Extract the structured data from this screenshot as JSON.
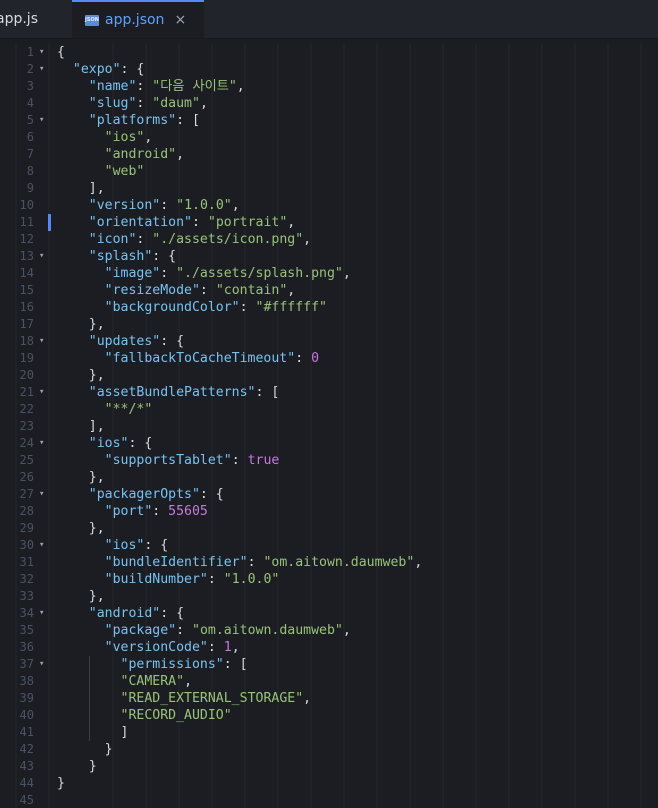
{
  "tabs": [
    {
      "label": "app.js",
      "active": false
    },
    {
      "label": "app.json",
      "active": true,
      "icon": "json-file-icon",
      "close": "×"
    }
  ],
  "icon_text": "JSON",
  "colors": {
    "background": "#1b1d23",
    "key": "#79c2f0",
    "string": "#98c379",
    "number": "#c678dd",
    "accent": "#568af2"
  },
  "lines": [
    {
      "n": "1",
      "fold": "▾",
      "t": [
        {
          "c": "p",
          "v": "{"
        }
      ]
    },
    {
      "n": "2",
      "fold": "▾",
      "t": [
        {
          "c": "p",
          "v": "  "
        },
        {
          "c": "k",
          "v": "\"expo\""
        },
        {
          "c": "p",
          "v": ": {"
        }
      ]
    },
    {
      "n": "3",
      "fold": "",
      "t": [
        {
          "c": "p",
          "v": "    "
        },
        {
          "c": "k",
          "v": "\"name\""
        },
        {
          "c": "p",
          "v": ": "
        },
        {
          "c": "s",
          "v": "\"다음 사이트\""
        },
        {
          "c": "p",
          "v": ","
        }
      ]
    },
    {
      "n": "4",
      "fold": "",
      "t": [
        {
          "c": "p",
          "v": "    "
        },
        {
          "c": "k",
          "v": "\"slug\""
        },
        {
          "c": "p",
          "v": ": "
        },
        {
          "c": "s",
          "v": "\"daum\""
        },
        {
          "c": "p",
          "v": ","
        }
      ]
    },
    {
      "n": "5",
      "fold": "▾",
      "t": [
        {
          "c": "p",
          "v": "    "
        },
        {
          "c": "k",
          "v": "\"platforms\""
        },
        {
          "c": "p",
          "v": ": ["
        }
      ]
    },
    {
      "n": "6",
      "fold": "",
      "t": [
        {
          "c": "p",
          "v": "      "
        },
        {
          "c": "s",
          "v": "\"ios\""
        },
        {
          "c": "p",
          "v": ","
        }
      ]
    },
    {
      "n": "7",
      "fold": "",
      "t": [
        {
          "c": "p",
          "v": "      "
        },
        {
          "c": "s",
          "v": "\"android\""
        },
        {
          "c": "p",
          "v": ","
        }
      ]
    },
    {
      "n": "8",
      "fold": "",
      "t": [
        {
          "c": "p",
          "v": "      "
        },
        {
          "c": "s",
          "v": "\"web\""
        }
      ]
    },
    {
      "n": "9",
      "fold": "",
      "t": [
        {
          "c": "p",
          "v": "    ],"
        }
      ]
    },
    {
      "n": "10",
      "fold": "",
      "t": [
        {
          "c": "p",
          "v": "    "
        },
        {
          "c": "k",
          "v": "\"version\""
        },
        {
          "c": "p",
          "v": ": "
        },
        {
          "c": "s",
          "v": "\"1.0.0\""
        },
        {
          "c": "p",
          "v": ","
        }
      ]
    },
    {
      "n": "11",
      "fold": "",
      "cursor": true,
      "t": [
        {
          "c": "p",
          "v": "    "
        },
        {
          "c": "k",
          "v": "\"orientation\""
        },
        {
          "c": "p",
          "v": ": "
        },
        {
          "c": "s",
          "v": "\"portrait\""
        },
        {
          "c": "p",
          "v": ","
        }
      ]
    },
    {
      "n": "12",
      "fold": "",
      "t": [
        {
          "c": "p",
          "v": "    "
        },
        {
          "c": "k",
          "v": "\"icon\""
        },
        {
          "c": "p",
          "v": ": "
        },
        {
          "c": "s",
          "v": "\"./assets/icon.png\""
        },
        {
          "c": "p",
          "v": ","
        }
      ]
    },
    {
      "n": "13",
      "fold": "▾",
      "t": [
        {
          "c": "p",
          "v": "    "
        },
        {
          "c": "k",
          "v": "\"splash\""
        },
        {
          "c": "p",
          "v": ": {"
        }
      ]
    },
    {
      "n": "14",
      "fold": "",
      "t": [
        {
          "c": "p",
          "v": "      "
        },
        {
          "c": "k",
          "v": "\"image\""
        },
        {
          "c": "p",
          "v": ": "
        },
        {
          "c": "s",
          "v": "\"./assets/splash.png\""
        },
        {
          "c": "p",
          "v": ","
        }
      ]
    },
    {
      "n": "15",
      "fold": "",
      "t": [
        {
          "c": "p",
          "v": "      "
        },
        {
          "c": "k",
          "v": "\"resizeMode\""
        },
        {
          "c": "p",
          "v": ": "
        },
        {
          "c": "s",
          "v": "\"contain\""
        },
        {
          "c": "p",
          "v": ","
        }
      ]
    },
    {
      "n": "16",
      "fold": "",
      "t": [
        {
          "c": "p",
          "v": "      "
        },
        {
          "c": "k",
          "v": "\"backgroundColor\""
        },
        {
          "c": "p",
          "v": ": "
        },
        {
          "c": "s",
          "v": "\"#ffffff\""
        }
      ]
    },
    {
      "n": "17",
      "fold": "",
      "t": [
        {
          "c": "p",
          "v": "    },"
        }
      ]
    },
    {
      "n": "18",
      "fold": "▾",
      "t": [
        {
          "c": "p",
          "v": "    "
        },
        {
          "c": "k",
          "v": "\"updates\""
        },
        {
          "c": "p",
          "v": ": {"
        }
      ]
    },
    {
      "n": "19",
      "fold": "",
      "t": [
        {
          "c": "p",
          "v": "      "
        },
        {
          "c": "k",
          "v": "\"fallbackToCacheTimeout\""
        },
        {
          "c": "p",
          "v": ": "
        },
        {
          "c": "n",
          "v": "0"
        }
      ]
    },
    {
      "n": "20",
      "fold": "",
      "t": [
        {
          "c": "p",
          "v": "    },"
        }
      ]
    },
    {
      "n": "21",
      "fold": "▾",
      "t": [
        {
          "c": "p",
          "v": "    "
        },
        {
          "c": "k",
          "v": "\"assetBundlePatterns\""
        },
        {
          "c": "p",
          "v": ": ["
        }
      ]
    },
    {
      "n": "22",
      "fold": "",
      "t": [
        {
          "c": "p",
          "v": "      "
        },
        {
          "c": "s",
          "v": "\"**/*\""
        }
      ]
    },
    {
      "n": "23",
      "fold": "",
      "t": [
        {
          "c": "p",
          "v": "    ],"
        }
      ]
    },
    {
      "n": "24",
      "fold": "▾",
      "t": [
        {
          "c": "p",
          "v": "    "
        },
        {
          "c": "k",
          "v": "\"ios\""
        },
        {
          "c": "p",
          "v": ": {"
        }
      ]
    },
    {
      "n": "25",
      "fold": "",
      "t": [
        {
          "c": "p",
          "v": "      "
        },
        {
          "c": "k",
          "v": "\"supportsTablet\""
        },
        {
          "c": "p",
          "v": ": "
        },
        {
          "c": "n",
          "v": "true"
        }
      ]
    },
    {
      "n": "26",
      "fold": "",
      "t": [
        {
          "c": "p",
          "v": "    },"
        }
      ]
    },
    {
      "n": "27",
      "fold": "▾",
      "t": [
        {
          "c": "p",
          "v": "    "
        },
        {
          "c": "k",
          "v": "\"packagerOpts\""
        },
        {
          "c": "p",
          "v": ": {"
        }
      ]
    },
    {
      "n": "28",
      "fold": "",
      "t": [
        {
          "c": "p",
          "v": "      "
        },
        {
          "c": "k",
          "v": "\"port\""
        },
        {
          "c": "p",
          "v": ": "
        },
        {
          "c": "n",
          "v": "55605"
        }
      ]
    },
    {
      "n": "29",
      "fold": "",
      "t": [
        {
          "c": "p",
          "v": "    },"
        }
      ]
    },
    {
      "n": "30",
      "fold": "▾",
      "t": [
        {
          "c": "p",
          "v": "      "
        },
        {
          "c": "k",
          "v": "\"ios\""
        },
        {
          "c": "p",
          "v": ": {"
        }
      ]
    },
    {
      "n": "31",
      "fold": "",
      "t": [
        {
          "c": "p",
          "v": "      "
        },
        {
          "c": "k",
          "v": "\"bundleIdentifier\""
        },
        {
          "c": "p",
          "v": ": "
        },
        {
          "c": "s",
          "v": "\"om.aitown.daumweb\""
        },
        {
          "c": "p",
          "v": ","
        }
      ]
    },
    {
      "n": "32",
      "fold": "",
      "t": [
        {
          "c": "p",
          "v": "      "
        },
        {
          "c": "k",
          "v": "\"buildNumber\""
        },
        {
          "c": "p",
          "v": ": "
        },
        {
          "c": "s",
          "v": "\"1.0.0\""
        }
      ]
    },
    {
      "n": "33",
      "fold": "",
      "t": [
        {
          "c": "p",
          "v": "    },"
        }
      ]
    },
    {
      "n": "34",
      "fold": "▾",
      "t": [
        {
          "c": "p",
          "v": "    "
        },
        {
          "c": "k",
          "v": "\"android\""
        },
        {
          "c": "p",
          "v": ": {"
        }
      ]
    },
    {
      "n": "35",
      "fold": "",
      "t": [
        {
          "c": "p",
          "v": "      "
        },
        {
          "c": "k",
          "v": "\"package\""
        },
        {
          "c": "p",
          "v": ": "
        },
        {
          "c": "s",
          "v": "\"om.aitown.daumweb\""
        },
        {
          "c": "p",
          "v": ","
        }
      ]
    },
    {
      "n": "36",
      "fold": "",
      "t": [
        {
          "c": "p",
          "v": "      "
        },
        {
          "c": "k",
          "v": "\"versionCode\""
        },
        {
          "c": "p",
          "v": ": "
        },
        {
          "c": "n",
          "v": "1"
        },
        {
          "c": "p",
          "v": ","
        }
      ]
    },
    {
      "n": "37",
      "fold": "▾",
      "guide": true,
      "t": [
        {
          "c": "p",
          "v": "        "
        },
        {
          "c": "k",
          "v": "\"permissions\""
        },
        {
          "c": "p",
          "v": ": ["
        }
      ]
    },
    {
      "n": "38",
      "fold": "",
      "guide": true,
      "t": [
        {
          "c": "p",
          "v": "        "
        },
        {
          "c": "s",
          "v": "\"CAMERA\""
        },
        {
          "c": "p",
          "v": ","
        }
      ]
    },
    {
      "n": "39",
      "fold": "",
      "guide": true,
      "t": [
        {
          "c": "p",
          "v": "        "
        },
        {
          "c": "s",
          "v": "\"READ_EXTERNAL_STORAGE\""
        },
        {
          "c": "p",
          "v": ","
        }
      ]
    },
    {
      "n": "40",
      "fold": "",
      "guide": true,
      "t": [
        {
          "c": "p",
          "v": "        "
        },
        {
          "c": "s",
          "v": "\"RECORD_AUDIO\""
        }
      ]
    },
    {
      "n": "41",
      "fold": "",
      "guide": true,
      "t": [
        {
          "c": "p",
          "v": "        ]"
        }
      ]
    },
    {
      "n": "42",
      "fold": "",
      "t": [
        {
          "c": "p",
          "v": "      }"
        }
      ]
    },
    {
      "n": "43",
      "fold": "",
      "t": [
        {
          "c": "p",
          "v": "    }"
        }
      ]
    },
    {
      "n": "44",
      "fold": "",
      "t": [
        {
          "c": "p",
          "v": "}"
        }
      ]
    },
    {
      "n": "45",
      "fold": "",
      "t": []
    }
  ]
}
